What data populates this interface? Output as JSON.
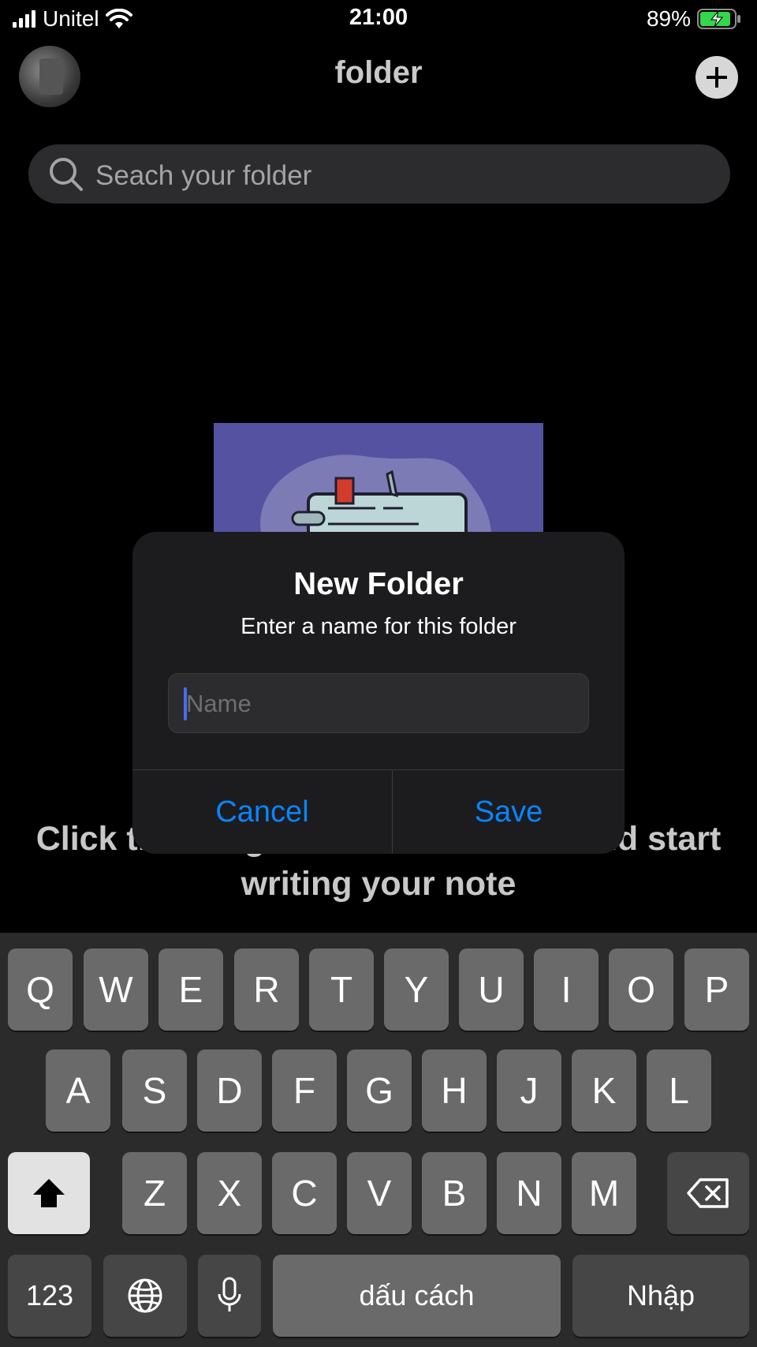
{
  "status_bar": {
    "carrier": "Unitel",
    "time": "21:00",
    "battery": "89%"
  },
  "header": {
    "title": "folder"
  },
  "search": {
    "placeholder": "Seach your folder"
  },
  "empty_state": {
    "message": "Click the + sign to create a folder and start writing your note"
  },
  "dialog": {
    "title": "New Folder",
    "message": "Enter a name for this folder",
    "input_placeholder": "Name",
    "cancel_label": "Cancel",
    "save_label": "Save"
  },
  "keyboard": {
    "row1": [
      "Q",
      "W",
      "E",
      "R",
      "T",
      "Y",
      "U",
      "I",
      "O",
      "P"
    ],
    "row2": [
      "A",
      "S",
      "D",
      "F",
      "G",
      "H",
      "J",
      "K",
      "L"
    ],
    "row3": [
      "Z",
      "X",
      "C",
      "V",
      "B",
      "N",
      "M"
    ],
    "numbers_label": "123",
    "space_label": "dấu cách",
    "return_label": "Nhập"
  },
  "colors": {
    "accent": "#0a84ff",
    "illustration_bg": "#5452a1"
  }
}
